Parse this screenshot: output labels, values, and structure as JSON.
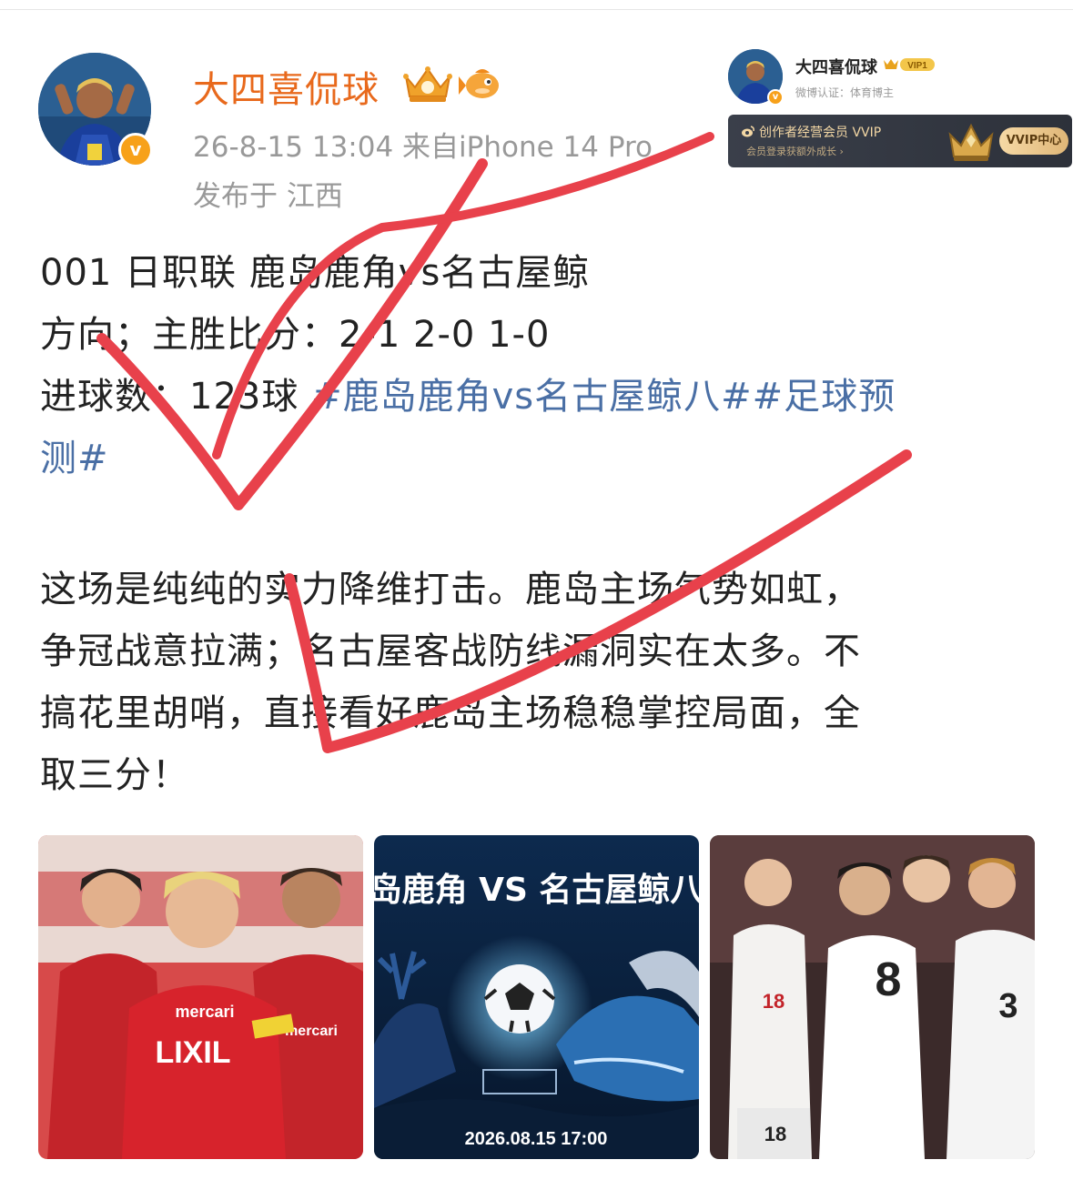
{
  "post": {
    "username": "大四喜侃球",
    "verify_badge": "v",
    "meta_line": "26-8-15 13:04  来自iPhone 14 Pro",
    "location": "发布于 江西",
    "lines": {
      "l1": "001  日职联  鹿岛鹿角vs名古屋鲸",
      "l2": "方向；主胜比分：2-1  2-0  1-0",
      "l3_prefix": "进球数：123球 ",
      "l3_topic": "#鹿岛鹿角vs名古屋鲸八##足球预",
      "l4_topic": "测#",
      "p2_l1": "这场是纯纯的实力降维打击。鹿岛主场气势如虹，",
      "p2_l2": "争冠战意拉满；名古屋客战防线漏洞实在太多。不",
      "p2_l3": "搞花里胡哨，直接看好鹿岛主场稳稳掌控局面，全",
      "p2_l4": "取三分！"
    }
  },
  "creator_card": {
    "name": "大四喜侃球",
    "vip_text": "VIP1",
    "cert": "微博认证：体育博主",
    "vvip_title": "创作者经营会员 VVIP",
    "vvip_sub": "会员登录获额外成长 ›",
    "vvip_button": "VVIP中心"
  },
  "images": {
    "poster_title": "岛鹿角 VS 名古屋鲸八",
    "poster_date": "2026.08.15 17:00",
    "jersey_sponsor": "LIXIL",
    "jersey_mercari": "mercari",
    "jersey_numbers": [
      "8",
      "18",
      "3",
      "18"
    ]
  },
  "colors": {
    "username": "#e8691c",
    "topic": "#4a6fa5",
    "tick": "#e8414b"
  },
  "icons": {
    "crown": "crown-icon",
    "fish": "fish-icon",
    "verify": "verified-badge-icon"
  }
}
